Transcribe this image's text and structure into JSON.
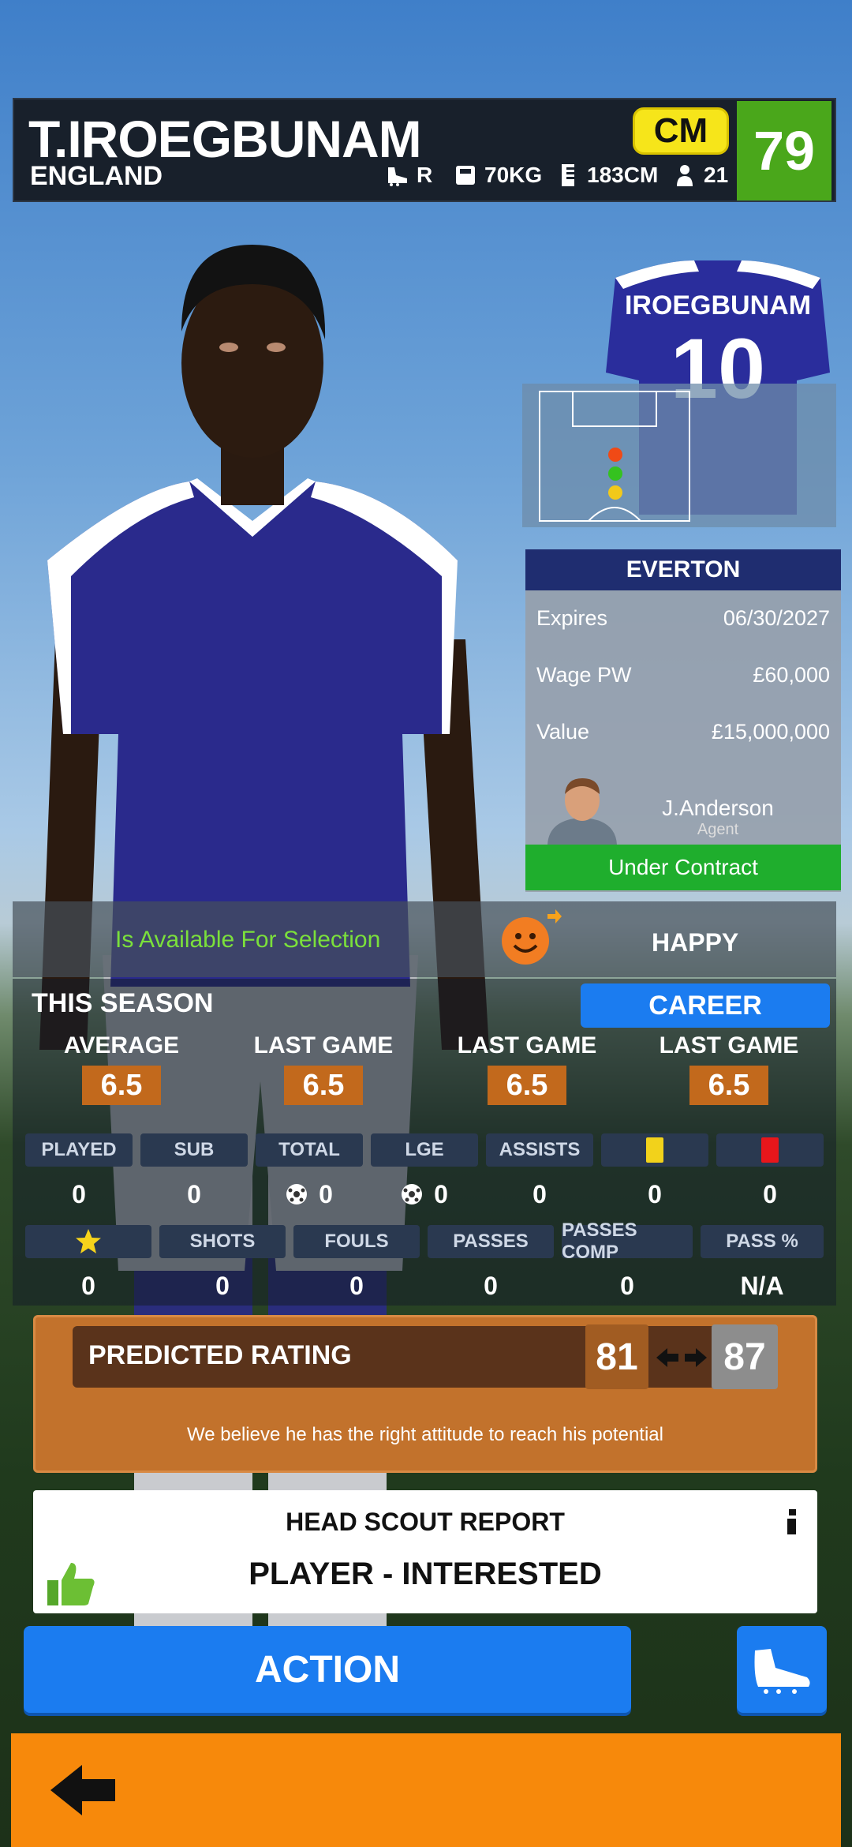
{
  "player": {
    "name": "T.IROEGBUNAM",
    "nation": "ENGLAND",
    "foot": "R",
    "weight": "70KG",
    "height": "183CM",
    "age": "21",
    "position": "CM",
    "rating": "79"
  },
  "shirt": {
    "name": "IROEGBUNAM",
    "number": "10",
    "color": "#2a2d9c"
  },
  "club": {
    "name": "EVERTON",
    "rows": [
      {
        "label": "Expires",
        "value": "06/30/2027"
      },
      {
        "label": "Wage PW",
        "value": "£60,000"
      },
      {
        "label": "Value",
        "value": "£15,000,000"
      }
    ],
    "agent_name": "J.Anderson",
    "agent_role": "Agent",
    "contract_status": "Under Contract"
  },
  "availability": {
    "text": "Is Available For Selection",
    "mood": "HAPPY",
    "mood_icon": "smiley-icon"
  },
  "season": {
    "label": "THIS SEASON",
    "career_button": "CAREER",
    "averages": [
      {
        "label": "AVERAGE",
        "value": "6.5"
      },
      {
        "label": "LAST GAME",
        "value": "6.5"
      },
      {
        "label": "LAST GAME",
        "value": "6.5"
      },
      {
        "label": "LAST GAME",
        "value": "6.5"
      }
    ],
    "row1": [
      {
        "header": "PLAYED",
        "value": "0"
      },
      {
        "header": "SUB",
        "value": "0"
      },
      {
        "header": "TOTAL",
        "value": "0",
        "icon": "ball-icon"
      },
      {
        "header": "LGE",
        "value": "0",
        "icon": "ball-icon"
      },
      {
        "header": "ASSISTS",
        "value": "0"
      },
      {
        "header_icon": "yellow-card-icon",
        "value": "0"
      },
      {
        "header_icon": "red-card-icon",
        "value": "0"
      }
    ],
    "row2": [
      {
        "header_icon": "star-icon",
        "value": "0"
      },
      {
        "header": "SHOTS",
        "value": "0"
      },
      {
        "header": "FOULS",
        "value": "0"
      },
      {
        "header": "PASSES",
        "value": "0"
      },
      {
        "header": "PASSES COMP",
        "value": "0"
      },
      {
        "header": "PASS %",
        "value": "N/A"
      }
    ]
  },
  "prediction": {
    "label": "PREDICTED RATING",
    "low": "81",
    "high": "87",
    "note": "We believe he has the right attitude to reach his potential"
  },
  "scout": {
    "title": "HEAD SCOUT REPORT",
    "status": "PLAYER - INTERESTED"
  },
  "buttons": {
    "action": "ACTION"
  }
}
